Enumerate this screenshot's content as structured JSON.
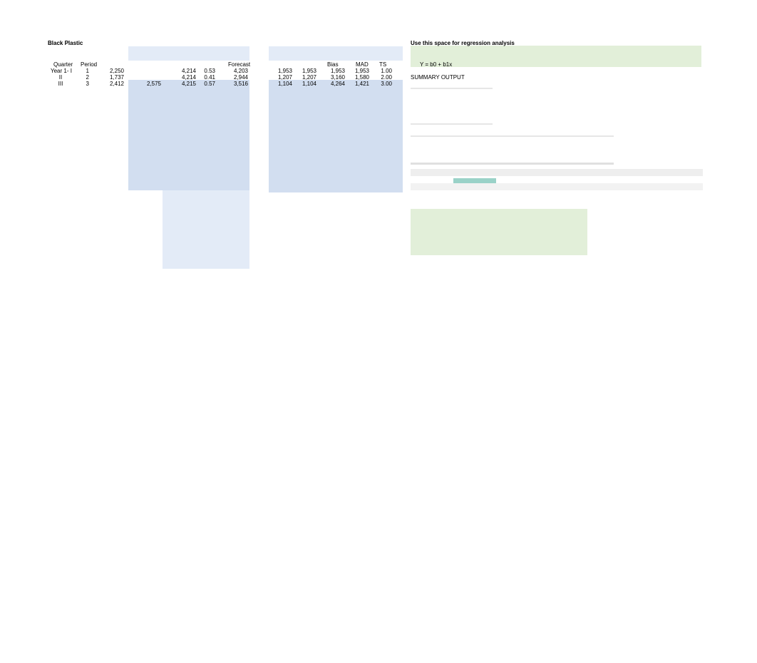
{
  "title": "Black Plastic",
  "regression_title": "Use this space for regression analysis",
  "summary_output": "SUMMARY OUTPUT",
  "equation": "Y = b0 + b1x",
  "table1": {
    "headers": {
      "quarter": "Quarter",
      "period": "Period",
      "forecast": "Forecast"
    },
    "rows": [
      {
        "q": "Year 1- I",
        "p": "1",
        "v": "2,250",
        "m": "",
        "f": "4,214",
        "r": "0.53",
        "fc": "4,203"
      },
      {
        "q": "II",
        "p": "2",
        "v": "1,737",
        "m": "",
        "f": "4,214",
        "r": "0.41",
        "fc": "2,944"
      },
      {
        "q": "III",
        "p": "3",
        "v": "2,412",
        "m": "2,575",
        "f": "4,215",
        "r": "0.57",
        "fc": "3,516"
      }
    ],
    "headers_right": {
      "bias": "Bias",
      "mad": "MAD",
      "ts": "TS"
    },
    "rows_right": [
      {
        "a": "1,953",
        "b": "1,953",
        "bias": "1,953",
        "mad": "1,953",
        "ts": "1.00"
      },
      {
        "a": "1,207",
        "b": "1,207",
        "bias": "3,160",
        "mad": "1,580",
        "ts": "2.00"
      },
      {
        "a": "1,104",
        "b": "1,104",
        "bias": "4,264",
        "mad": "1,421",
        "ts": "3.00"
      }
    ]
  }
}
